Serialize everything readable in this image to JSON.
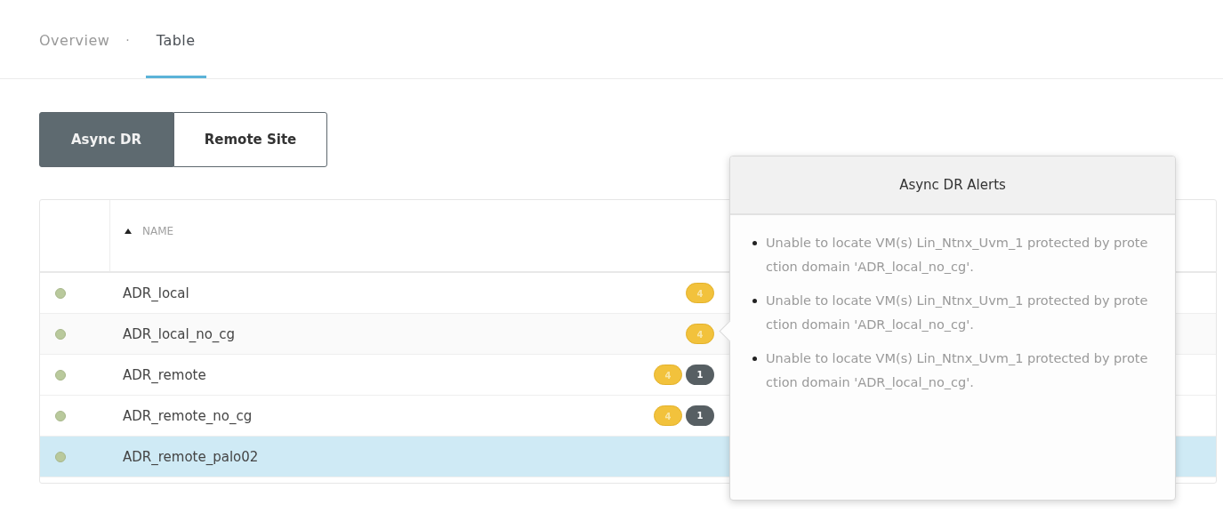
{
  "tabs": [
    {
      "label": "Overview",
      "selected": false
    },
    {
      "label": "Table",
      "selected": true
    }
  ],
  "tab_separator": "·",
  "segments": [
    {
      "label": "Async DR",
      "selected": true
    },
    {
      "label": "Remote Site",
      "selected": false
    }
  ],
  "table": {
    "columns": [
      {
        "label": "NAME",
        "sorted_ascending": true
      }
    ],
    "rows": [
      {
        "name": "ADR_local",
        "selected": false,
        "badges": [
          {
            "kind": "warning",
            "text": "4"
          }
        ]
      },
      {
        "name": "ADR_local_no_cg",
        "selected": false,
        "badges": [
          {
            "kind": "warning",
            "text": "4"
          }
        ]
      },
      {
        "name": "ADR_remote",
        "selected": false,
        "badges": [
          {
            "kind": "warning",
            "text": "4"
          },
          {
            "kind": "info",
            "text": "1"
          }
        ]
      },
      {
        "name": "ADR_remote_no_cg",
        "selected": false,
        "badges": [
          {
            "kind": "warning",
            "text": "4"
          },
          {
            "kind": "info",
            "text": "1"
          }
        ]
      },
      {
        "name": "ADR_remote_palo02",
        "selected": true,
        "badges": []
      }
    ]
  },
  "popover": {
    "title": "Async DR Alerts",
    "items": [
      "Unable to locate VM(s) Lin_Ntnx_Uvm_1 protected by protection domain 'ADR_local_no_cg'.",
      "Unable to locate VM(s) Lin_Ntnx_Uvm_1 protected by protection domain 'ADR_local_no_cg'.",
      "Unable to locate VM(s) Lin_Ntnx_Uvm_1 protected by protection domain 'ADR_local_no_cg'."
    ]
  }
}
